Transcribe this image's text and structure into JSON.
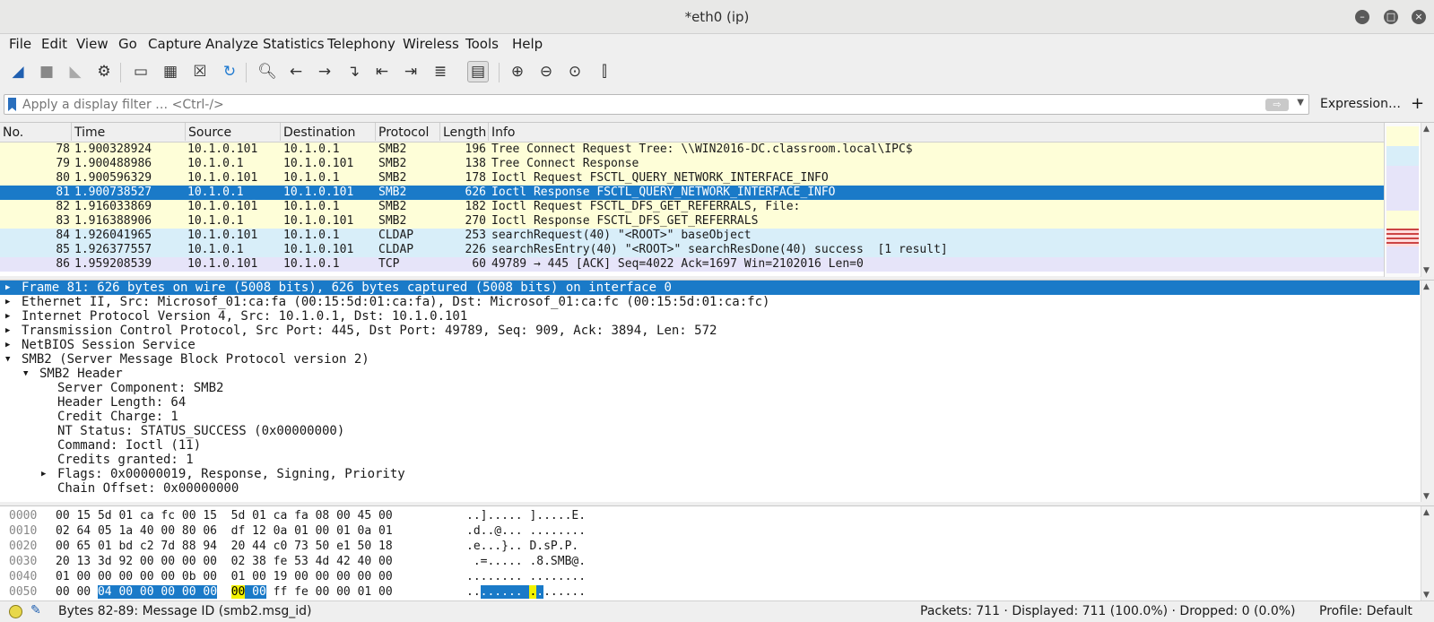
{
  "window": {
    "title": "*eth0 (ip)"
  },
  "menu": [
    "File",
    "Edit",
    "View",
    "Go",
    "Capture",
    "Analyze",
    "Statistics",
    "Telephony",
    "Wireless",
    "Tools",
    "Help"
  ],
  "filter": {
    "placeholder": "Apply a display filter … <Ctrl-/>",
    "expression_label": "Expression…",
    "plus_label": "+"
  },
  "packet_list": {
    "columns": [
      "No.",
      "Time",
      "Source",
      "Destination",
      "Protocol",
      "Length",
      "Info"
    ],
    "rows": [
      {
        "no": "78",
        "time": "1.900328924",
        "src": "10.1.0.101",
        "dst": "10.1.0.1",
        "proto": "SMB2",
        "len": "196",
        "info": "Tree Connect Request Tree: \\\\WIN2016-DC.classroom.local\\IPC$",
        "bg": "#fefed8"
      },
      {
        "no": "79",
        "time": "1.900488986",
        "src": "10.1.0.1",
        "dst": "10.1.0.101",
        "proto": "SMB2",
        "len": "138",
        "info": "Tree Connect Response",
        "bg": "#fefed8"
      },
      {
        "no": "80",
        "time": "1.900596329",
        "src": "10.1.0.101",
        "dst": "10.1.0.1",
        "proto": "SMB2",
        "len": "178",
        "info": "Ioctl Request FSCTL_QUERY_NETWORK_INTERFACE_INFO",
        "bg": "#fefed8"
      },
      {
        "no": "81",
        "time": "1.900738527",
        "src": "10.1.0.1",
        "dst": "10.1.0.101",
        "proto": "SMB2",
        "len": "626",
        "info": "Ioctl Response FSCTL_QUERY_NETWORK_INTERFACE_INFO",
        "bg": "#1a7ac8",
        "selected": true
      },
      {
        "no": "82",
        "time": "1.916033869",
        "src": "10.1.0.101",
        "dst": "10.1.0.1",
        "proto": "SMB2",
        "len": "182",
        "info": "Ioctl Request FSCTL_DFS_GET_REFERRALS, File:",
        "bg": "#fefed8"
      },
      {
        "no": "83",
        "time": "1.916388906",
        "src": "10.1.0.1",
        "dst": "10.1.0.101",
        "proto": "SMB2",
        "len": "270",
        "info": "Ioctl Response FSCTL_DFS_GET_REFERRALS",
        "bg": "#fefed8"
      },
      {
        "no": "84",
        "time": "1.926041965",
        "src": "10.1.0.101",
        "dst": "10.1.0.1",
        "proto": "CLDAP",
        "len": "253",
        "info": "searchRequest(40) \"<ROOT>\" baseObject",
        "bg": "#d8eef9"
      },
      {
        "no": "85",
        "time": "1.926377557",
        "src": "10.1.0.1",
        "dst": "10.1.0.101",
        "proto": "CLDAP",
        "len": "226",
        "info": "searchResEntry(40) \"<ROOT>\" searchResDone(40) success  [1 result]",
        "bg": "#d8eef9"
      },
      {
        "no": "86",
        "time": "1.959208539",
        "src": "10.1.0.101",
        "dst": "10.1.0.1",
        "proto": "TCP",
        "len": "60",
        "info": "49789 → 445 [ACK] Seq=4022 Ack=1697 Win=2102016 Len=0",
        "bg": "#e6e4f9"
      }
    ]
  },
  "details": [
    {
      "indent": 0,
      "tri": "right",
      "text": "Frame 81: 626 bytes on wire (5008 bits), 626 bytes captured (5008 bits) on interface 0",
      "selected": true
    },
    {
      "indent": 0,
      "tri": "right",
      "text": "Ethernet II, Src: Microsof_01:ca:fa (00:15:5d:01:ca:fa), Dst: Microsof_01:ca:fc (00:15:5d:01:ca:fc)"
    },
    {
      "indent": 0,
      "tri": "right",
      "text": "Internet Protocol Version 4, Src: 10.1.0.1, Dst: 10.1.0.101"
    },
    {
      "indent": 0,
      "tri": "right",
      "text": "Transmission Control Protocol, Src Port: 445, Dst Port: 49789, Seq: 909, Ack: 3894, Len: 572"
    },
    {
      "indent": 0,
      "tri": "right",
      "text": "NetBIOS Session Service"
    },
    {
      "indent": 0,
      "tri": "down",
      "text": "SMB2 (Server Message Block Protocol version 2)"
    },
    {
      "indent": 1,
      "tri": "down",
      "text": "SMB2 Header"
    },
    {
      "indent": 2,
      "tri": "",
      "text": "Server Component: SMB2"
    },
    {
      "indent": 2,
      "tri": "",
      "text": "Header Length: 64"
    },
    {
      "indent": 2,
      "tri": "",
      "text": "Credit Charge: 1"
    },
    {
      "indent": 2,
      "tri": "",
      "text": "NT Status: STATUS_SUCCESS (0x00000000)"
    },
    {
      "indent": 2,
      "tri": "",
      "text": "Command: Ioctl (11)"
    },
    {
      "indent": 2,
      "tri": "",
      "text": "Credits granted: 1"
    },
    {
      "indent": 2,
      "tri": "right",
      "text": "Flags: 0x00000019, Response, Signing, Priority"
    },
    {
      "indent": 2,
      "tri": "",
      "text": "Chain Offset: 0x00000000"
    }
  ],
  "hex": [
    {
      "off": "0000",
      "a": "00 15 5d 01 ca fc 00 15",
      "b": "5d 01 ca fa 08 00 45 00",
      "ascii": "..]..... ].....E."
    },
    {
      "off": "0010",
      "a": "02 64 05 1a 40 00 80 06",
      "b": "df 12 0a 01 00 01 0a 01",
      "ascii": ".d..@... ........"
    },
    {
      "off": "0020",
      "a": "00 65 01 bd c2 7d 88 94",
      "b": "20 44 c0 73 50 e1 50 18",
      "ascii": ".e...}.. D.sP.P."
    },
    {
      "off": "0030",
      "a": "20 13 3d 92 00 00 00 00",
      "b": "02 38 fe 53 4d 42 40 00",
      "ascii": " .=..... .8.SMB@."
    },
    {
      "off": "0040",
      "a": "01 00 00 00 00 00 0b 00",
      "b": "01 00 19 00 00 00 00 00",
      "ascii": "........ ........"
    },
    {
      "off": "0050",
      "a_pre": "00 00 ",
      "a_hl": "04 00 00 00 00 00",
      "b_yl": "00",
      "b_hl": "00",
      "b_rest": "ff fe 00 00 01 00",
      "ascii_pre": "..",
      "ascii_hl": "......",
      "ascii_mid": " ",
      "ascii_yl": ".",
      "ascii_hl2": ".",
      "ascii_rest": "......"
    }
  ],
  "status": {
    "field": "Bytes 82-89: Message ID (smb2.msg_id)",
    "packets": "Packets: 711 · Displayed: 711 (100.0%) · Dropped: 0 (0.0%)",
    "profile": "Profile: Default"
  }
}
